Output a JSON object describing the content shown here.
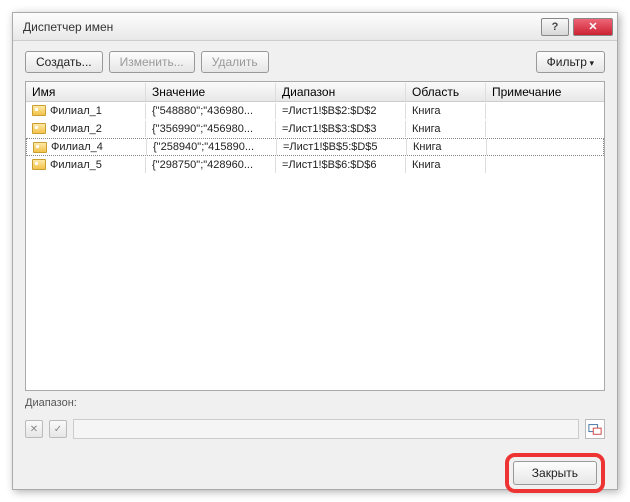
{
  "title": "Диспетчер имен",
  "buttons": {
    "new": "Создать...",
    "edit": "Изменить...",
    "delete": "Удалить",
    "filter": "Фильтр",
    "close": "Закрыть"
  },
  "columns": {
    "name": "Имя",
    "value": "Значение",
    "range": "Диапазон",
    "scope": "Область",
    "comment": "Примечание"
  },
  "rows": [
    {
      "name": "Филиал_1",
      "value": "{\"548880\";\"436980...",
      "range": "=Лист1!$B$2:$D$2",
      "scope": "Книга",
      "comment": ""
    },
    {
      "name": "Филиал_2",
      "value": "{\"356990\";\"456980...",
      "range": "=Лист1!$B$3:$D$3",
      "scope": "Книга",
      "comment": ""
    },
    {
      "name": "Филиал_4",
      "value": "{\"258940\";\"415890...",
      "range": "=Лист1!$B$5:$D$5",
      "scope": "Книга",
      "comment": ""
    },
    {
      "name": "Филиал_5",
      "value": "{\"298750\";\"428960...",
      "range": "=Лист1!$B$6:$D$6",
      "scope": "Книга",
      "comment": ""
    }
  ],
  "selected_index": 2,
  "rangeLabel": "Диапазон:",
  "rangeValue": ""
}
